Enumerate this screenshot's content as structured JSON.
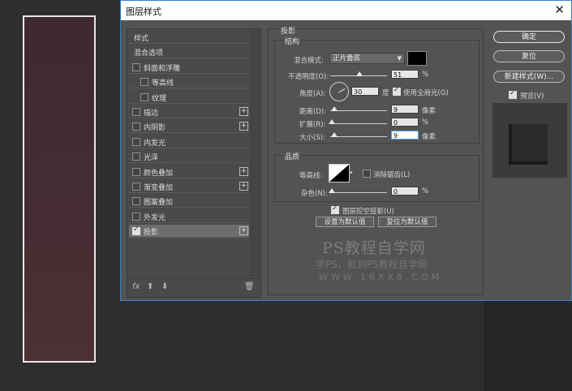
{
  "dialog": {
    "title": "图层样式",
    "close": "✕"
  },
  "styles_list": [
    {
      "label": "样式",
      "checkbox": false,
      "checked": false,
      "plus": false,
      "indent": 0,
      "selected": false
    },
    {
      "label": "混合选项",
      "checkbox": false,
      "checked": false,
      "plus": false,
      "indent": 0,
      "selected": false
    },
    {
      "label": "斜面和浮雕",
      "checkbox": true,
      "checked": false,
      "plus": false,
      "indent": 0,
      "selected": false
    },
    {
      "label": "等高线",
      "checkbox": true,
      "checked": false,
      "plus": false,
      "indent": 1,
      "selected": false
    },
    {
      "label": "纹理",
      "checkbox": true,
      "checked": false,
      "plus": false,
      "indent": 1,
      "selected": false
    },
    {
      "label": "描边",
      "checkbox": true,
      "checked": false,
      "plus": true,
      "indent": 0,
      "selected": false
    },
    {
      "label": "内阴影",
      "checkbox": true,
      "checked": false,
      "plus": true,
      "indent": 0,
      "selected": false
    },
    {
      "label": "内发光",
      "checkbox": true,
      "checked": false,
      "plus": false,
      "indent": 0,
      "selected": false
    },
    {
      "label": "光泽",
      "checkbox": true,
      "checked": false,
      "plus": false,
      "indent": 0,
      "selected": false
    },
    {
      "label": "颜色叠加",
      "checkbox": true,
      "checked": false,
      "plus": true,
      "indent": 0,
      "selected": false
    },
    {
      "label": "渐变叠加",
      "checkbox": true,
      "checked": false,
      "plus": true,
      "indent": 0,
      "selected": false
    },
    {
      "label": "图案叠加",
      "checkbox": true,
      "checked": false,
      "plus": false,
      "indent": 0,
      "selected": false
    },
    {
      "label": "外发光",
      "checkbox": true,
      "checked": false,
      "plus": false,
      "indent": 0,
      "selected": false
    },
    {
      "label": "投影",
      "checkbox": true,
      "checked": true,
      "plus": true,
      "indent": 0,
      "selected": true
    }
  ],
  "list_footer": {
    "fx": "fx",
    "up": "⬆",
    "down": "⬇",
    "trash": "🗑"
  },
  "drop_shadow": {
    "section_title": "投影",
    "structure": {
      "title": "结构",
      "blend_mode_label": "混合模式:",
      "blend_mode_value": "正片叠底",
      "shadow_color": "#000000",
      "opacity_label": "不透明度(O):",
      "opacity_value": "51",
      "opacity_unit": "%",
      "opacity_level": 51,
      "angle_label": "角度(A):",
      "angle_value": "30",
      "angle_unit": "度",
      "global_light_label": "使用全局光(G)",
      "global_light_checked": true,
      "distance_label": "距离(D):",
      "distance_value": "9",
      "distance_unit": "像素",
      "spread_label": "扩展(R):",
      "spread_value": "0",
      "spread_unit": "%",
      "size_label": "大小(S):",
      "size_value": "9",
      "size_unit": "像素"
    },
    "quality": {
      "title": "品质",
      "contour_label": "等高线:",
      "antialias_label": "消除锯齿(L)",
      "antialias_checked": false,
      "noise_label": "杂色(N):",
      "noise_value": "0",
      "noise_unit": "%"
    },
    "knockout_label": "图层挖空投影(U)",
    "knockout_checked": true,
    "set_default": "设置为默认值",
    "reset_default": "复位为默认值"
  },
  "buttons": {
    "ok": "确定",
    "reset": "复位",
    "new_style": "新建样式(W)...",
    "preview_label": "预览(V)",
    "preview_checked": true
  },
  "watermark": {
    "line1": "PS教程自学网",
    "line2": "学PS，就到PS教程自学网",
    "line3": "WWW.16XX8.COM"
  }
}
